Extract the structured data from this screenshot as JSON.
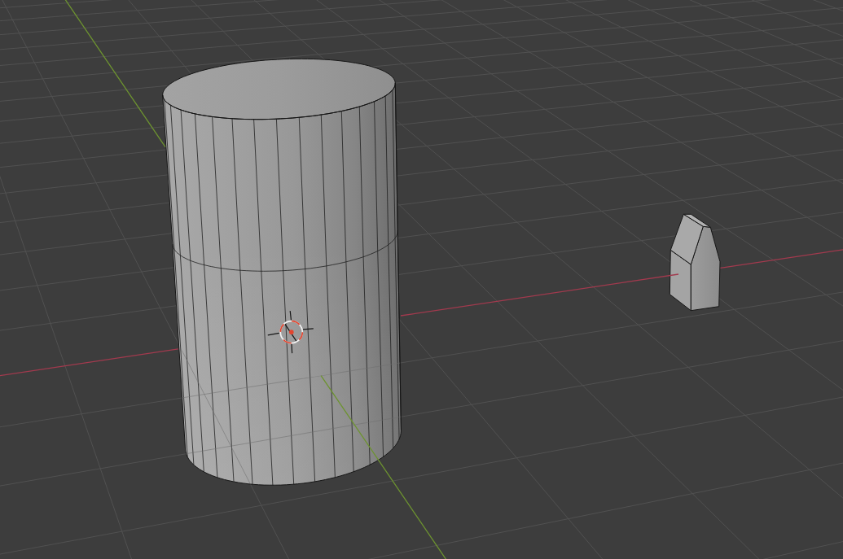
{
  "viewport": {
    "axes": [
      {
        "kind": "x",
        "color": "#a23a4e"
      },
      {
        "kind": "y",
        "color": "#6d9330"
      }
    ],
    "scene": [
      {
        "kind": "cylinder"
      },
      {
        "kind": "prism"
      },
      {
        "kind": "cursor"
      }
    ]
  }
}
